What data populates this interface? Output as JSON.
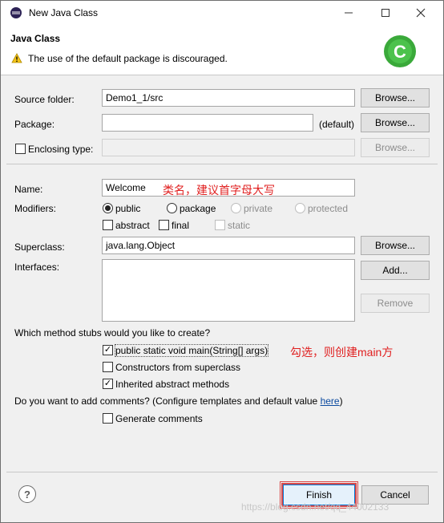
{
  "window": {
    "title": "New Java Class",
    "controls": [
      "minimize-icon",
      "maximize-icon",
      "close-icon"
    ]
  },
  "banner": {
    "title": "Java Class",
    "message": "The use of the default package is discouraged.",
    "logo_icon": "eclipse-class-icon",
    "logo_text": "C"
  },
  "form": {
    "source_folder": {
      "label": "Source folder:",
      "value": "Demo1_1/src",
      "button": "Browse..."
    },
    "package": {
      "label": "Package:",
      "value": "",
      "suffix": "(default)",
      "button": "Browse..."
    },
    "enclosing_type": {
      "label": "Enclosing type:",
      "value": "",
      "button": "Browse..."
    },
    "name": {
      "label": "Name:",
      "value": "Welcome"
    },
    "modifiers": {
      "label": "Modifiers:",
      "public": "public",
      "package": "package",
      "private": "private",
      "protected": "protected",
      "abstract": "abstract",
      "final": "final",
      "static": "static"
    },
    "superclass": {
      "label": "Superclass:",
      "value": "java.lang.Object",
      "button": "Browse..."
    },
    "interfaces": {
      "label": "Interfaces:",
      "add": "Add...",
      "remove": "Remove"
    },
    "stubs": {
      "question": "Which method stubs would you like to create?",
      "main": "public static void main(String[] args)",
      "constructors": "Constructors from superclass",
      "inherited": "Inherited abstract methods"
    },
    "comments": {
      "question_prefix": "Do you want to add comments? (Configure templates and default value ",
      "link": "here",
      "question_suffix": ")",
      "generate": "Generate comments"
    }
  },
  "annotations": {
    "name_note": "类名，建议首字母大写",
    "main_note": "勾选，则创建main方"
  },
  "footer": {
    "help": "?",
    "finish": "Finish",
    "cancel": "Cancel",
    "watermark": "https://blog.csdn.net/qq_44002133"
  },
  "colors": {
    "annotation": "#e02020",
    "accent": "#0078d7",
    "logo": "#3aa93a"
  }
}
